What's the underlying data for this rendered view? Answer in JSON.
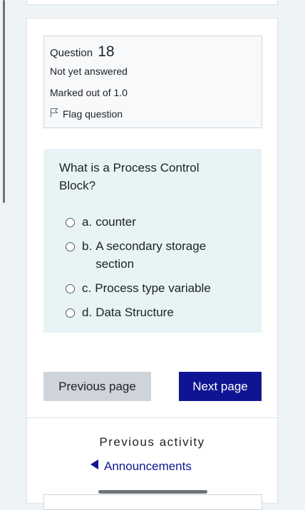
{
  "question_info": {
    "question_label": "Question",
    "question_number": "18",
    "status": "Not yet answered",
    "marks": "Marked out of 1.0",
    "flag_label": "Flag question"
  },
  "question": {
    "text": "What is a Process Control Block?",
    "options": [
      {
        "letter": "a.",
        "text": "counter"
      },
      {
        "letter": "b.",
        "text": "A secondary storage section"
      },
      {
        "letter": "c.",
        "text": "Process type variable"
      },
      {
        "letter": "d.",
        "text": "Data Structure"
      }
    ]
  },
  "navigation": {
    "previous_label": "Previous page",
    "next_label": "Next page"
  },
  "activity_nav": {
    "heading": "Previous activity",
    "link_label": "Announcements"
  },
  "colors": {
    "primary": "#0f1592",
    "secondary_button": "#ced4da",
    "question_bg": "#e7f3f5"
  },
  "icons": {
    "flag": "flag-icon",
    "back": "caret-left-icon"
  }
}
